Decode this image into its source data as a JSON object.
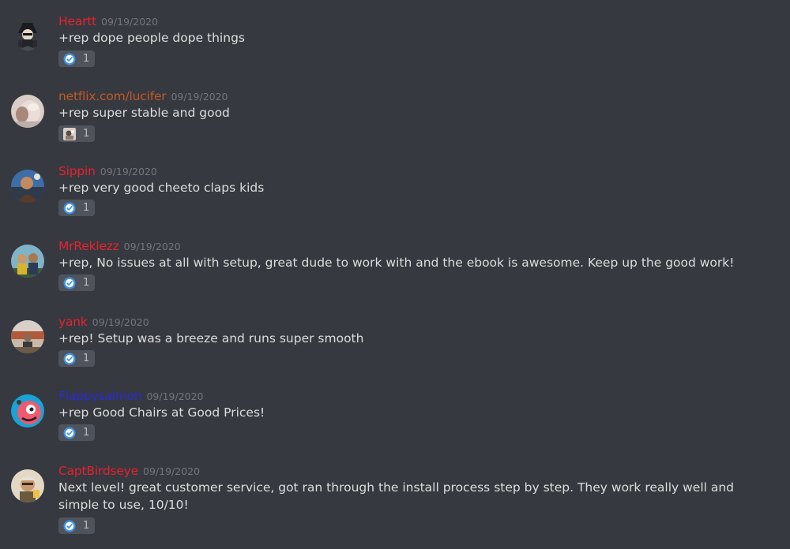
{
  "messages": [
    {
      "username": "Heartt",
      "name_color": "#e8222f",
      "timestamp": "09/19/2020",
      "text": "+rep dope people dope things",
      "reaction": {
        "emoji": "verified-check-icon",
        "count": "1"
      }
    },
    {
      "username": "netflix.com/lucifer",
      "name_color": "#c05a26",
      "timestamp": "09/19/2020",
      "text": "+rep super stable and good",
      "reaction": {
        "emoji": "custom-avatar-emoji-icon",
        "count": "1"
      }
    },
    {
      "username": "Sippin",
      "name_color": "#e8222f",
      "timestamp": "09/19/2020",
      "text": "+rep very good cheeto claps kids",
      "reaction": {
        "emoji": "verified-check-icon",
        "count": "1"
      }
    },
    {
      "username": "MrReklezz",
      "name_color": "#e8222f",
      "timestamp": "09/19/2020",
      "text": "+rep, No issues at all with setup, great dude to work with and the ebook is awesome. Keep up the good work!",
      "reaction": {
        "emoji": "verified-check-icon",
        "count": "1"
      }
    },
    {
      "username": "yank",
      "name_color": "#e8222f",
      "timestamp": "09/19/2020",
      "text": "+rep! Setup was a breeze and runs super smooth",
      "reaction": {
        "emoji": "verified-check-icon",
        "count": "1"
      }
    },
    {
      "username": "Flappysalmon",
      "name_color": "#2a2ad8",
      "timestamp": "09/19/2020",
      "text": "+rep Good Chairs at Good Prices!",
      "reaction": {
        "emoji": "verified-check-icon",
        "count": "1"
      }
    },
    {
      "username": "CaptBirdseye",
      "name_color": "#e8222f",
      "timestamp": "09/19/2020",
      "text": "Next level! great customer service, got ran through the install process step by step. They work really well and simple to use, 10/10!",
      "reaction": {
        "emoji": "verified-check-icon",
        "count": "1"
      }
    }
  ]
}
